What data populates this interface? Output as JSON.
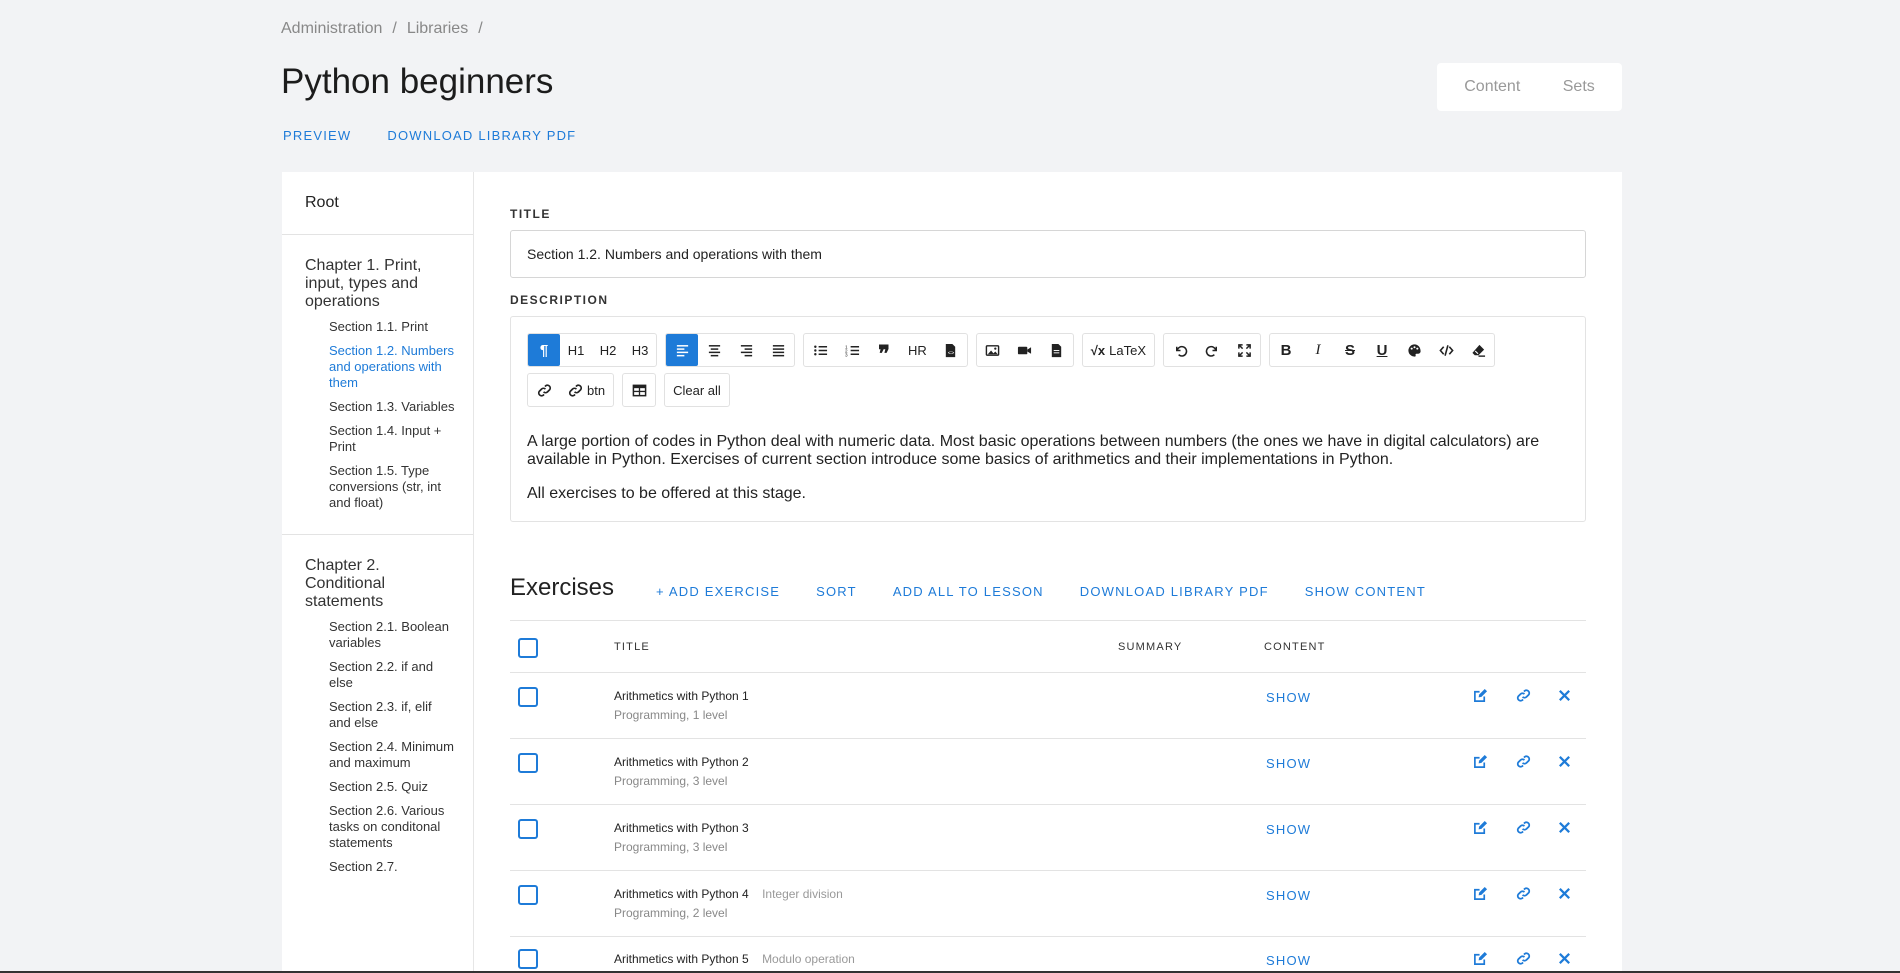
{
  "breadcrumb": {
    "items": [
      "Administration",
      "Libraries"
    ],
    "separator": "/"
  },
  "page": {
    "title": "Python beginners"
  },
  "top_links": {
    "preview": "PREVIEW",
    "download": "DOWNLOAD LIBRARY PDF"
  },
  "view_toggle": {
    "content": "Content",
    "sets": "Sets"
  },
  "sidebar": {
    "root": "Root",
    "chapters": [
      {
        "title": "Chapter 1. Print, input, types and operations",
        "sections": [
          {
            "label": "Section 1.1. Print",
            "active": false
          },
          {
            "label": "Section 1.2. Numbers and operations with them",
            "active": true
          },
          {
            "label": "Section 1.3. Variables",
            "active": false
          },
          {
            "label": "Section 1.4. Input + Print",
            "active": false
          },
          {
            "label": "Section 1.5. Type conversions (str, int and float)",
            "active": false
          }
        ]
      },
      {
        "title": "Chapter 2. Conditional statements",
        "sections": [
          {
            "label": "Section 2.1. Boolean variables",
            "active": false
          },
          {
            "label": "Section 2.2. if and else",
            "active": false
          },
          {
            "label": "Section 2.3. if, elif and else",
            "active": false
          },
          {
            "label": "Section 2.4. Minimum and maximum",
            "active": false
          },
          {
            "label": "Section 2.5. Quiz",
            "active": false
          },
          {
            "label": "Section 2.6. Various tasks on conditonal statements",
            "active": false
          },
          {
            "label": "Section 2.7.",
            "active": false
          }
        ]
      }
    ]
  },
  "form": {
    "title_label": "TITLE",
    "title_value": "Section 1.2. Numbers and operations with them",
    "description_label": "DESCRIPTION"
  },
  "toolbar": {
    "h1": "H1",
    "h2": "H2",
    "h3": "H3",
    "hr": "HR",
    "latex": "LaTeX",
    "btn": "btn",
    "clear_all": "Clear all"
  },
  "editor": {
    "paragraph1": "A large portion of codes in Python deal with numeric data. Most basic operations between numbers (the ones we have in digital calculators) are available in Python. Exercises of current section introduce some basics of arithmetics and their implementations in Python.",
    "paragraph2": "All exercises to be offered at this stage."
  },
  "exercises": {
    "heading": "Exercises",
    "actions": {
      "add": "+ ADD EXERCISE",
      "sort": "SORT",
      "add_all": "ADD ALL TO LESSON",
      "download": "DOWNLOAD LIBRARY PDF",
      "show_content": "SHOW CONTENT"
    },
    "columns": {
      "title": "TITLE",
      "summary": "SUMMARY",
      "content": "CONTENT"
    },
    "show_label": "SHOW",
    "rows": [
      {
        "title": "Arithmetics with Python 1",
        "summary": "",
        "meta": "Programming, 1 level"
      },
      {
        "title": "Arithmetics with Python 2",
        "summary": "",
        "meta": "Programming, 3 level"
      },
      {
        "title": "Arithmetics with Python 3",
        "summary": "",
        "meta": "Programming, 3 level"
      },
      {
        "title": "Arithmetics with Python 4",
        "summary": "Integer division",
        "meta": "Programming, 2 level"
      },
      {
        "title": "Arithmetics with Python 5",
        "summary": "Modulo operation",
        "meta": ""
      }
    ]
  },
  "colors": {
    "accent": "#1e7bd8",
    "background": "#f2f3f5"
  }
}
